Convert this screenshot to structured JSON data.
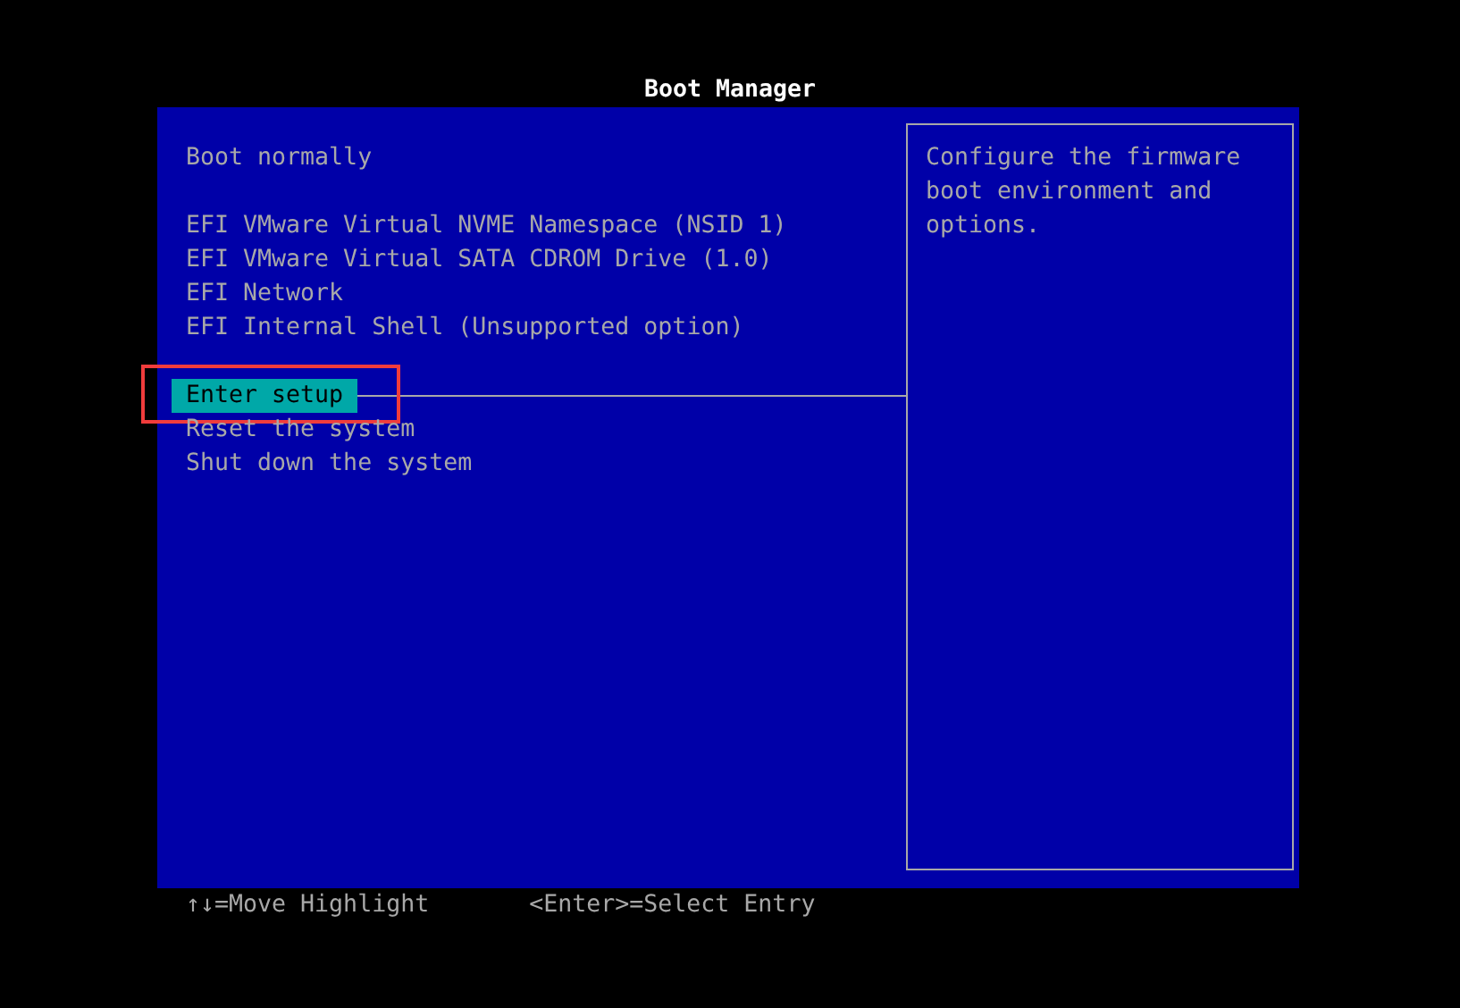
{
  "title": "Boot Manager",
  "groups": [
    {
      "items": [
        {
          "label": "Boot normally",
          "selected": false,
          "annotated": false
        }
      ]
    },
    {
      "items": [
        {
          "label": "EFI VMware Virtual NVME Namespace (NSID 1)",
          "selected": false,
          "annotated": false
        },
        {
          "label": "EFI VMware Virtual SATA CDROM Drive (1.0)",
          "selected": false,
          "annotated": false
        },
        {
          "label": "EFI Network",
          "selected": false,
          "annotated": false
        },
        {
          "label": "EFI Internal Shell (Unsupported option)",
          "selected": false,
          "annotated": false
        }
      ]
    },
    {
      "items": [
        {
          "label": "Enter setup",
          "selected": true,
          "annotated": true
        },
        {
          "label": "Reset the system",
          "selected": false,
          "annotated": false
        },
        {
          "label": "Shut down the system",
          "selected": false,
          "annotated": false
        }
      ]
    }
  ],
  "help_text": "Configure the firmware boot environment and options.",
  "footer": [
    "↑↓=Move Highlight",
    "<Enter>=Select Entry"
  ]
}
